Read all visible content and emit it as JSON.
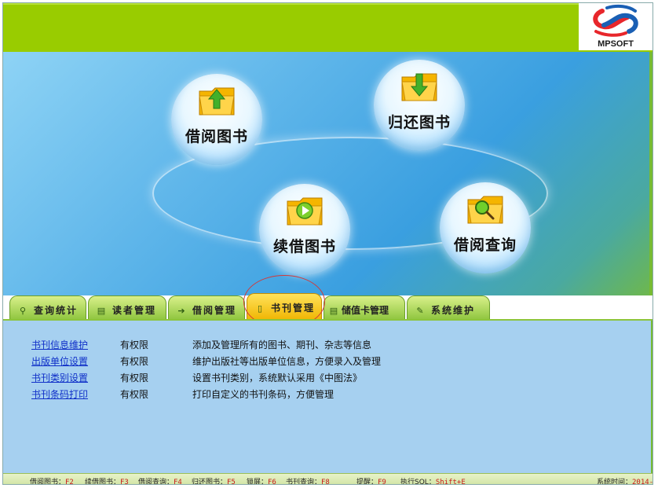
{
  "header": {
    "brand": "MPSOFT"
  },
  "bubbles": [
    {
      "id": "borrow",
      "label": "借阅图书",
      "icon": "folder-up-arrow-icon"
    },
    {
      "id": "return",
      "label": "归还图书",
      "icon": "folder-down-arrow-icon"
    },
    {
      "id": "renew",
      "label": "续借图书",
      "icon": "folder-play-icon"
    },
    {
      "id": "query",
      "label": "借阅查询",
      "icon": "folder-search-icon"
    }
  ],
  "tabs": [
    {
      "label": "查询统计",
      "icon": "search-icon",
      "glyph": "⚲"
    },
    {
      "label": "读者管理",
      "icon": "document-icon",
      "glyph": "▤"
    },
    {
      "label": "借阅管理",
      "icon": "arrow-right-icon",
      "glyph": "➔"
    },
    {
      "label": "书刊管理",
      "icon": "page-icon",
      "glyph": "▯",
      "active": true
    },
    {
      "label": "储值卡管理",
      "icon": "card-icon",
      "glyph": "▤"
    },
    {
      "label": "系统维护",
      "icon": "wrench-icon",
      "glyph": "✎"
    }
  ],
  "rows": [
    {
      "link": "书刊信息维护",
      "perm": "有权限",
      "desc": "添加及管理所有的图书、期刊、杂志等信息"
    },
    {
      "link": "出版单位设置",
      "perm": "有权限",
      "desc": "维护出版社等出版单位信息，方便录入及管理"
    },
    {
      "link": "书刊类别设置",
      "perm": "有权限",
      "desc": "设置书刊类别，系统默认采用《中图法》"
    },
    {
      "link": "书刊条码打印",
      "perm": "有权限",
      "desc": "打印自定义的书刊条码，方便管理"
    }
  ],
  "status": [
    {
      "label": "借阅图书：",
      "key": "F2"
    },
    {
      "label": "续借图书：",
      "key": "F3"
    },
    {
      "label": "借阅查询：",
      "key": "F4"
    },
    {
      "label": "归还图书：",
      "key": "F5"
    },
    {
      "label": "锁屏：",
      "key": "F6"
    },
    {
      "label": "书刊查询：",
      "key": "F8"
    },
    {
      "label": "提醒：",
      "key": "F9"
    },
    {
      "label": "执行SQL：",
      "key": "Shift+E"
    }
  ],
  "system_time": {
    "label": "系统时间：",
    "value": "2014-"
  },
  "colors": {
    "header_green": "#99cc00",
    "tab_active": "#f0b400",
    "content_blue": "#a6d0f0",
    "link_blue": "#1030c8"
  }
}
